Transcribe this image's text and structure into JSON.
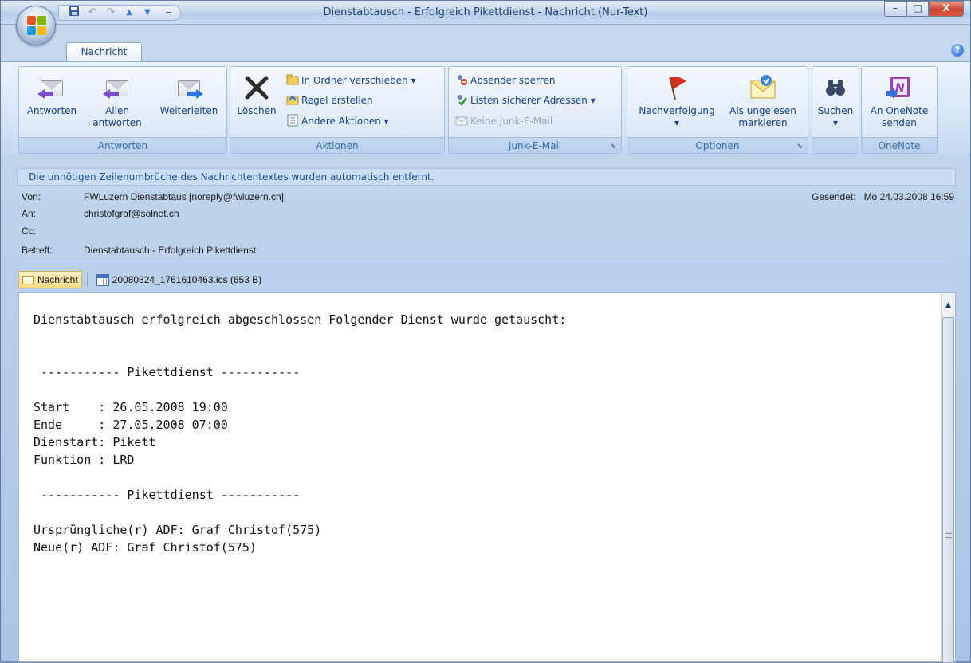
{
  "window": {
    "title": "Dienstabtausch - Erfolgreich Pikettdienst - Nachricht (Nur-Text)",
    "min_label": "–",
    "max_label": "□",
    "close_label": "X"
  },
  "qat": {
    "save_icon": "floppy-icon",
    "undo_glyph": "↶",
    "redo_glyph": "↷",
    "up_glyph": "▲",
    "down_glyph": "▼",
    "customize_glyph": "="
  },
  "tabs": {
    "active": "Nachricht"
  },
  "help_label": "?",
  "ribbon": {
    "groups": {
      "antworten": {
        "label": "Antworten",
        "reply": "Antworten",
        "reply_all_1": "Allen",
        "reply_all_2": "antworten",
        "forward": "Weiterleiten"
      },
      "aktionen": {
        "label": "Aktionen",
        "delete": "Löschen",
        "move": "In Ordner verschieben ▾",
        "rule": "Regel erstellen",
        "other": "Andere Aktionen ▾"
      },
      "junk": {
        "label": "Junk-E-Mail",
        "block": "Absender sperren",
        "safe_lists": "Listen sicherer Adressen ▾",
        "not_junk": "Keine Junk-E-Mail"
      },
      "optionen": {
        "label": "Optionen",
        "followup": "Nachverfolgung",
        "followup_arrow": "▾",
        "unread_1": "Als ungelesen",
        "unread_2": "markieren"
      },
      "suchen": {
        "label": "Suchen",
        "arrow": "▾"
      },
      "onenote": {
        "label": "OneNote",
        "send_1": "An OneNote",
        "send_2": "senden"
      }
    }
  },
  "infobar": "Die unnötigen Zeilenumbrüche des Nachrichtentextes wurden automatisch entfernt.",
  "header": {
    "from_label": "Von:",
    "from": "FWLuzern Dienstabtaus [noreply@fwluzern.ch]",
    "to_label": "An:",
    "to": "christofgraf@solnet.ch",
    "cc_label": "Cc:",
    "cc": "",
    "subject_label": "Betreff:",
    "subject": "Dienstabtausch - Erfolgreich Pikettdienst",
    "sent_label": "Gesendet:",
    "sent": "Mo 24.03.2008 16:59"
  },
  "attachments": {
    "message_tab": "Nachricht",
    "file": "20080324_1761610463.ics (653 B)"
  },
  "body": {
    "lines": [
      "Dienstabtausch erfolgreich abgeschlossen Folgender Dienst wurde getauscht:",
      "",
      "",
      " ----------- Pikettdienst -----------",
      "",
      "Start    : 26.05.2008 19:00",
      "Ende     : 27.05.2008 07:00",
      "Dienstart: Pikett",
      "Funktion : LRD",
      "",
      " ----------- Pikettdienst -----------",
      "",
      "Ursprüngliche(r) ADF: Graf Christof(575)",
      "Neue(r) ADF: Graf Christof(575)"
    ]
  },
  "colors": {
    "ribbon_text": "#15428b",
    "group_label": "#3e6aaa",
    "flag_red": "#d8301f",
    "reply_arrow": "#7b4fc9",
    "forward_arrow": "#2d74d8"
  }
}
